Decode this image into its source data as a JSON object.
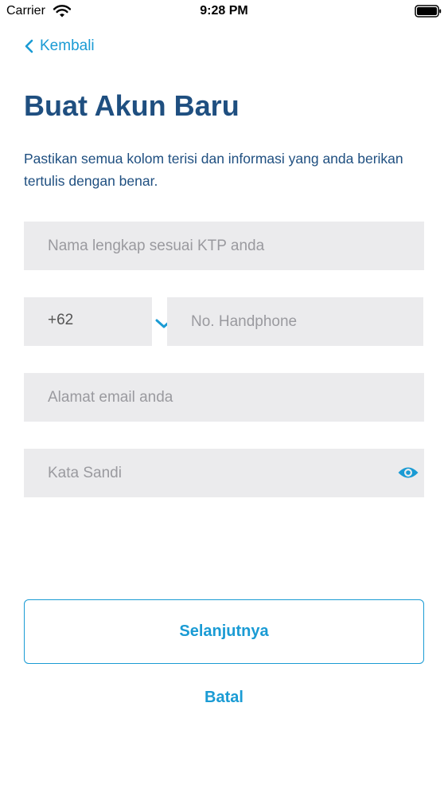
{
  "status_bar": {
    "carrier": "Carrier",
    "time": "9:28 PM"
  },
  "nav": {
    "back_label": "Kembali"
  },
  "page": {
    "title": "Buat Akun Baru",
    "subtitle": "Pastikan semua kolom terisi dan informasi yang anda berikan tertulis dengan benar."
  },
  "form": {
    "name_placeholder": "Nama lengkap sesuai KTP anda",
    "country_code": "+62",
    "phone_placeholder": "No. Handphone",
    "email_placeholder": "Alamat email anda",
    "password_placeholder": "Kata Sandi"
  },
  "actions": {
    "next_label": "Selanjutnya",
    "cancel_label": "Batal"
  },
  "icons": [
    "wifi-icon",
    "battery-icon",
    "chevron-left-icon",
    "chevron-down-icon",
    "eye-icon"
  ],
  "colors": {
    "accent": "#1a9bd4",
    "title": "#1f4f80",
    "field_bg": "#ebebed"
  }
}
